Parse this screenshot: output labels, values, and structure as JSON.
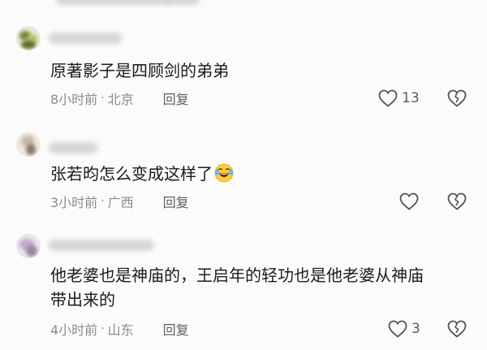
{
  "comments": [
    {
      "text_lines": [
        "原著影子是四顾剑的弟弟"
      ],
      "time": "8小时前",
      "location": "北京",
      "reply_label": "回复",
      "like_count": "13",
      "has_emoji": false
    },
    {
      "text_lines": [
        "张若昀怎么变成这样了"
      ],
      "time": "3小时前",
      "location": "广西",
      "reply_label": "回复",
      "like_count": "",
      "has_emoji": true
    },
    {
      "text_lines": [
        "他老婆也是神庙的，王启年的轻功也是他老婆从神庙",
        "带出来的"
      ],
      "time": "4小时前",
      "location": "山东",
      "reply_label": "回复",
      "like_count": "3",
      "has_emoji": false
    }
  ],
  "colors": {
    "background": "#fbfbfb",
    "text": "#1b1b1b",
    "meta": "#8b8b8b",
    "icon": "#555555"
  }
}
